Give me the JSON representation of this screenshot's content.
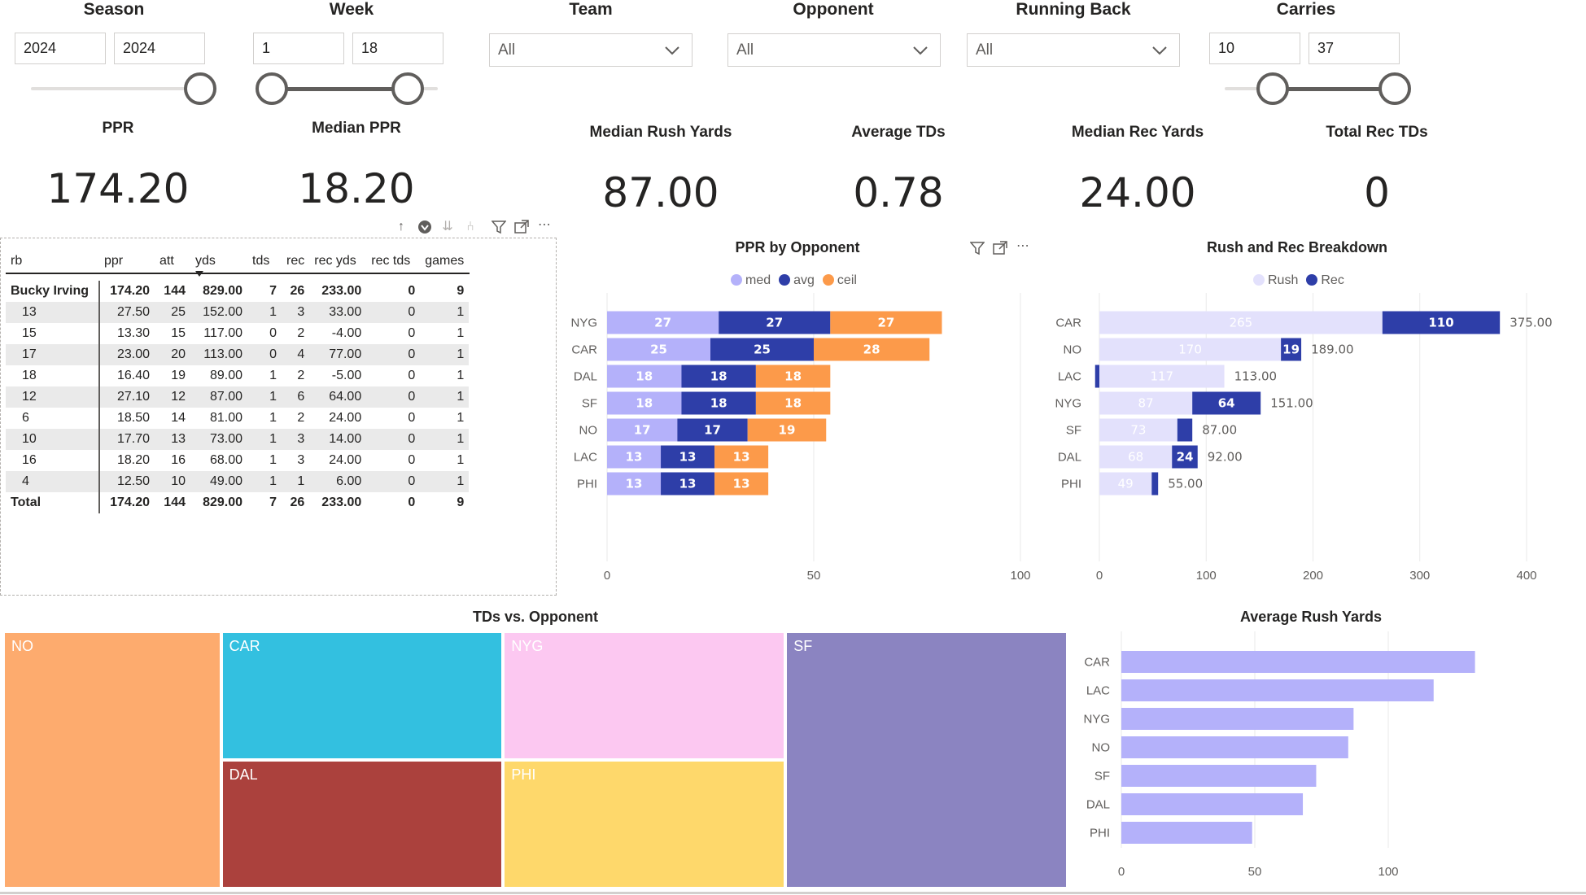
{
  "slicers": {
    "season": {
      "title": "Season",
      "from": "2024",
      "to": "2024"
    },
    "week": {
      "title": "Week",
      "from": "1",
      "to": "18"
    },
    "team": {
      "title": "Team",
      "value": "All"
    },
    "opponent": {
      "title": "Opponent",
      "value": "All"
    },
    "running_back": {
      "title": "Running Back",
      "value": "All"
    },
    "carries": {
      "title": "Carries",
      "from": "10",
      "to": "37"
    }
  },
  "cards": [
    {
      "label": "PPR",
      "value": "174.20"
    },
    {
      "label": "Median PPR",
      "value": "18.20"
    },
    {
      "label": "Median Rush Yards",
      "value": "87.00"
    },
    {
      "label": "Average TDs",
      "value": "0.78"
    },
    {
      "label": "Median Rec Yards",
      "value": "24.00"
    },
    {
      "label": "Total Rec TDs",
      "value": "0"
    }
  ],
  "table": {
    "columns": [
      "rb",
      "ppr",
      "att",
      "yds",
      "tds",
      "rec",
      "rec yds",
      "rec tds",
      "games"
    ],
    "sort_column": "yds",
    "header_row": [
      "Bucky Irving",
      "174.20",
      "144",
      "829.00",
      "7",
      "26",
      "233.00",
      "0",
      "9"
    ],
    "rows": [
      [
        "13",
        "27.50",
        "25",
        "152.00",
        "1",
        "3",
        "33.00",
        "0",
        "1"
      ],
      [
        "15",
        "13.30",
        "15",
        "117.00",
        "0",
        "2",
        "-4.00",
        "0",
        "1"
      ],
      [
        "17",
        "23.00",
        "20",
        "113.00",
        "0",
        "4",
        "77.00",
        "0",
        "1"
      ],
      [
        "18",
        "16.40",
        "19",
        "89.00",
        "1",
        "2",
        "-5.00",
        "0",
        "1"
      ],
      [
        "12",
        "27.10",
        "12",
        "87.00",
        "1",
        "6",
        "64.00",
        "0",
        "1"
      ],
      [
        "6",
        "18.50",
        "14",
        "81.00",
        "1",
        "2",
        "24.00",
        "0",
        "1"
      ],
      [
        "10",
        "17.70",
        "13",
        "73.00",
        "1",
        "3",
        "14.00",
        "0",
        "1"
      ],
      [
        "16",
        "18.20",
        "16",
        "68.00",
        "1",
        "3",
        "24.00",
        "0",
        "1"
      ],
      [
        "4",
        "12.50",
        "10",
        "49.00",
        "1",
        "1",
        "6.00",
        "0",
        "1"
      ]
    ],
    "total_row": [
      "Total",
      "174.20",
      "144",
      "829.00",
      "7",
      "26",
      "233.00",
      "0",
      "9"
    ]
  },
  "colors": {
    "med": "#b4b1fa",
    "avg": "#2e3ea8",
    "ceil": "#fc9a4a",
    "rush": "#e3e1fc",
    "rec": "#2e3ea8",
    "avg_rush": "#b4b1fa"
  },
  "chart_data": [
    {
      "type": "bar",
      "orientation": "horizontal",
      "stacked": true,
      "title": "PPR by Opponent",
      "legend": "top-center",
      "categories": [
        "NYG",
        "CAR",
        "DAL",
        "SF",
        "NO",
        "LAC",
        "PHI"
      ],
      "series": [
        {
          "name": "med",
          "values": [
            27,
            25,
            18,
            18,
            17,
            13,
            13
          ]
        },
        {
          "name": "avg",
          "values": [
            27,
            25,
            18,
            18,
            17,
            13,
            13
          ]
        },
        {
          "name": "ceil",
          "values": [
            27,
            28,
            18,
            18,
            19,
            13,
            13
          ]
        }
      ],
      "xlim": [
        0,
        100
      ],
      "xticks": [
        "0",
        "50",
        "100"
      ]
    },
    {
      "type": "bar",
      "orientation": "horizontal",
      "stacked": true,
      "title": "Rush and Rec Breakdown",
      "legend": "top-center",
      "categories": [
        "CAR",
        "NO",
        "LAC",
        "NYG",
        "SF",
        "DAL",
        "PHI"
      ],
      "series": [
        {
          "name": "Rush",
          "values": [
            265,
            170,
            117,
            87,
            73,
            68,
            49
          ]
        },
        {
          "name": "Rec",
          "values": [
            110,
            19,
            -4,
            64,
            14,
            24,
            6
          ]
        }
      ],
      "totals": [
        "375.00",
        "189.00",
        "113.00",
        "151.00",
        "87.00",
        "92.00",
        "55.00"
      ],
      "rush_labels": [
        "265",
        "170",
        "117",
        "87",
        "73",
        "68",
        "49"
      ],
      "rec_labels": [
        "110",
        "19",
        "",
        "64",
        "",
        "24",
        ""
      ],
      "xlim": [
        -4,
        400
      ],
      "xticks": [
        "0",
        "100",
        "200",
        "300",
        "400"
      ]
    },
    {
      "type": "treemap",
      "title": "TDs vs. Opponent",
      "items": [
        {
          "label": "NO",
          "value": 2,
          "color": "#fdab6e"
        },
        {
          "label": "CAR",
          "value": 1,
          "color": "#33c0e0"
        },
        {
          "label": "NYG",
          "value": 1,
          "color": "#fcc8f1"
        },
        {
          "label": "DAL",
          "value": 1,
          "color": "#ab413d"
        },
        {
          "label": "PHI",
          "value": 1,
          "color": "#fed86b"
        },
        {
          "label": "SF",
          "value": 1,
          "color": "#8b84c1"
        }
      ]
    },
    {
      "type": "bar",
      "orientation": "horizontal",
      "title": "Average Rush Yards",
      "categories": [
        "CAR",
        "LAC",
        "NYG",
        "NO",
        "SF",
        "DAL",
        "PHI"
      ],
      "values": [
        132.5,
        117,
        87,
        85,
        73,
        68,
        49
      ],
      "xlim": [
        0,
        150
      ],
      "xticks": [
        "0",
        "50",
        "100"
      ]
    }
  ]
}
